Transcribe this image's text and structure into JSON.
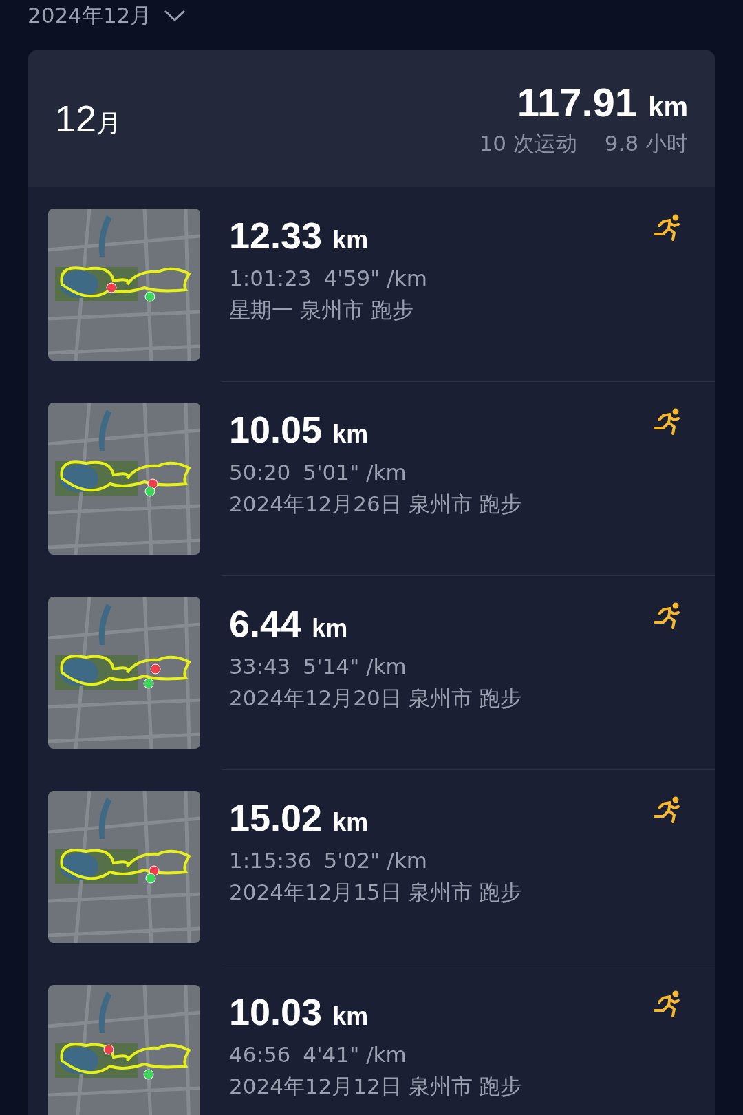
{
  "header": {
    "month_picker": "2024年12月"
  },
  "summary": {
    "month_number": "12",
    "month_unit": "月",
    "distance": "117.91",
    "distance_unit": "km",
    "workouts": "10 次运动",
    "duration": "9.8 小时"
  },
  "activities": [
    {
      "kind": "run",
      "distance": "12.33",
      "unit": "km",
      "duration": "1:01:23",
      "pace": "4'59\" /km",
      "date_place": "星期一 泉州市 跑步"
    },
    {
      "kind": "run",
      "distance": "10.05",
      "unit": "km",
      "duration": "50:20",
      "pace": "5'01\" /km",
      "date_place": "2024年12月26日 泉州市 跑步"
    },
    {
      "kind": "run",
      "distance": "6.44",
      "unit": "km",
      "duration": "33:43",
      "pace": "5'14\" /km",
      "date_place": "2024年12月20日 泉州市 跑步"
    },
    {
      "kind": "run",
      "distance": "15.02",
      "unit": "km",
      "duration": "1:15:36",
      "pace": "5'02\" /km",
      "date_place": "2024年12月15日 泉州市 跑步"
    },
    {
      "kind": "run",
      "distance": "10.03",
      "unit": "km",
      "duration": "46:56",
      "pace": "4'41\" /km",
      "date_place": "2024年12月12日 泉州市 跑步"
    }
  ]
}
